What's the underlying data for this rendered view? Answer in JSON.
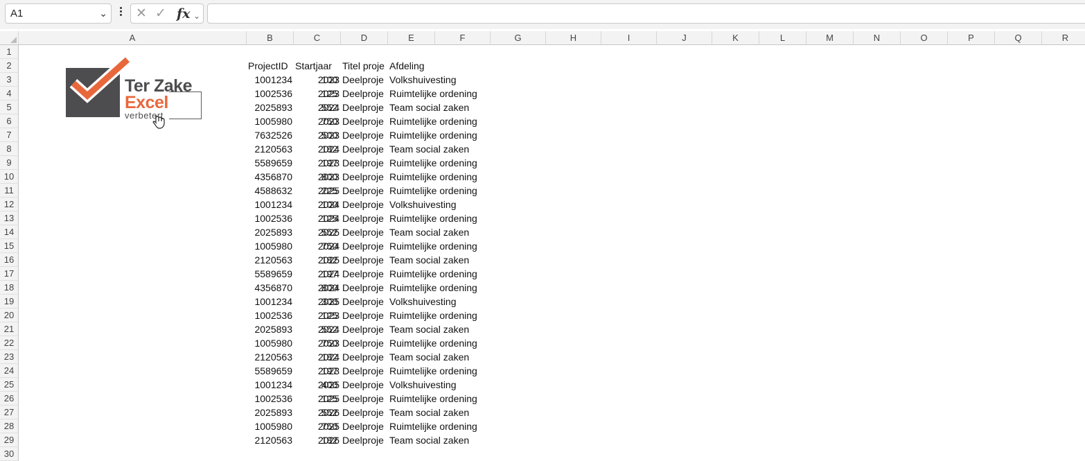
{
  "formula_bar": {
    "name_box": "A1",
    "cancel_icon": "✕",
    "enter_icon": "✓",
    "fx_label": "fx",
    "formula": ""
  },
  "columns": [
    "A",
    "B",
    "C",
    "D",
    "E",
    "F",
    "G",
    "H",
    "I",
    "J",
    "K",
    "L",
    "M",
    "N",
    "O",
    "P",
    "Q",
    "R"
  ],
  "row_numbers": [
    "1",
    "2",
    "3",
    "4",
    "5",
    "6",
    "7",
    "8",
    "9",
    "10",
    "11",
    "12",
    "13",
    "14",
    "15",
    "16",
    "17",
    "18",
    "19",
    "20",
    "21",
    "22",
    "23",
    "24",
    "25",
    "26",
    "27",
    "28",
    "29",
    "30"
  ],
  "logo": {
    "line1": "Ter Zake",
    "line2": "Excel",
    "line3": "verbetert",
    "check_color": "#e8683c",
    "box_color": "#4d4d4f"
  },
  "table": {
    "headers": [
      "ProjectID",
      "Startjaar",
      "Titel proje",
      "Afdeling"
    ],
    "rows": [
      [
        "1001234",
        "2023",
        "100",
        "Deelproje",
        "Volkshuivesting"
      ],
      [
        "1002536",
        "2023",
        "125",
        "Deelproje",
        "Ruimtelijke ordening"
      ],
      [
        "2025893",
        "2024",
        "552",
        "Deelproje",
        "Team social zaken"
      ],
      [
        "1005980",
        "2023",
        "750",
        "Deelproje",
        "Ruimtelijke ordening"
      ],
      [
        "7632526",
        "2023",
        "500",
        "Deelproje",
        "Ruimtelijke ordening"
      ],
      [
        "2120563",
        "2024",
        "182",
        "Deelproje",
        "Team social zaken"
      ],
      [
        "5589659",
        "2023",
        "197",
        "Deelproje",
        "Ruimtelijke ordening"
      ],
      [
        "4356870",
        "2023",
        "800",
        "Deelproje",
        "Ruimtelijke ordening"
      ],
      [
        "4588632",
        "2025",
        "225",
        "Deelproje",
        "Ruimtelijke ordening"
      ],
      [
        "1001234",
        "2024",
        "100",
        "Deelproje",
        "Volkshuivesting"
      ],
      [
        "1002536",
        "2024",
        "125",
        "Deelproje",
        "Ruimtelijke ordening"
      ],
      [
        "2025893",
        "2025",
        "552",
        "Deelproje",
        "Team social zaken"
      ],
      [
        "1005980",
        "2024",
        "750",
        "Deelproje",
        "Ruimtelijke ordening"
      ],
      [
        "2120563",
        "2025",
        "182",
        "Deelproje",
        "Team social zaken"
      ],
      [
        "5589659",
        "2024",
        "197",
        "Deelproje",
        "Ruimtelijke ordening"
      ],
      [
        "4356870",
        "2024",
        "800",
        "Deelproje",
        "Ruimtelijke ordening"
      ],
      [
        "1001234",
        "2025",
        "300",
        "Deelproje",
        "Volkshuivesting"
      ],
      [
        "1002536",
        "2023",
        "125",
        "Deelproje",
        "Ruimtelijke ordening"
      ],
      [
        "2025893",
        "2024",
        "552",
        "Deelproje",
        "Team social zaken"
      ],
      [
        "1005980",
        "2023",
        "750",
        "Deelproje",
        "Ruimtelijke ordening"
      ],
      [
        "2120563",
        "2024",
        "182",
        "Deelproje",
        "Team social zaken"
      ],
      [
        "5589659",
        "2023",
        "197",
        "Deelproje",
        "Ruimtelijke ordening"
      ],
      [
        "1001234",
        "2025",
        "400",
        "Deelproje",
        "Volkshuivesting"
      ],
      [
        "1002536",
        "2025",
        "125",
        "Deelproje",
        "Ruimtelijke ordening"
      ],
      [
        "2025893",
        "2026",
        "552",
        "Deelproje",
        "Team social zaken"
      ],
      [
        "1005980",
        "2025",
        "750",
        "Deelproje",
        "Ruimtelijke ordening"
      ],
      [
        "2120563",
        "2026",
        "182",
        "Deelproje",
        "Team social zaken"
      ]
    ]
  }
}
